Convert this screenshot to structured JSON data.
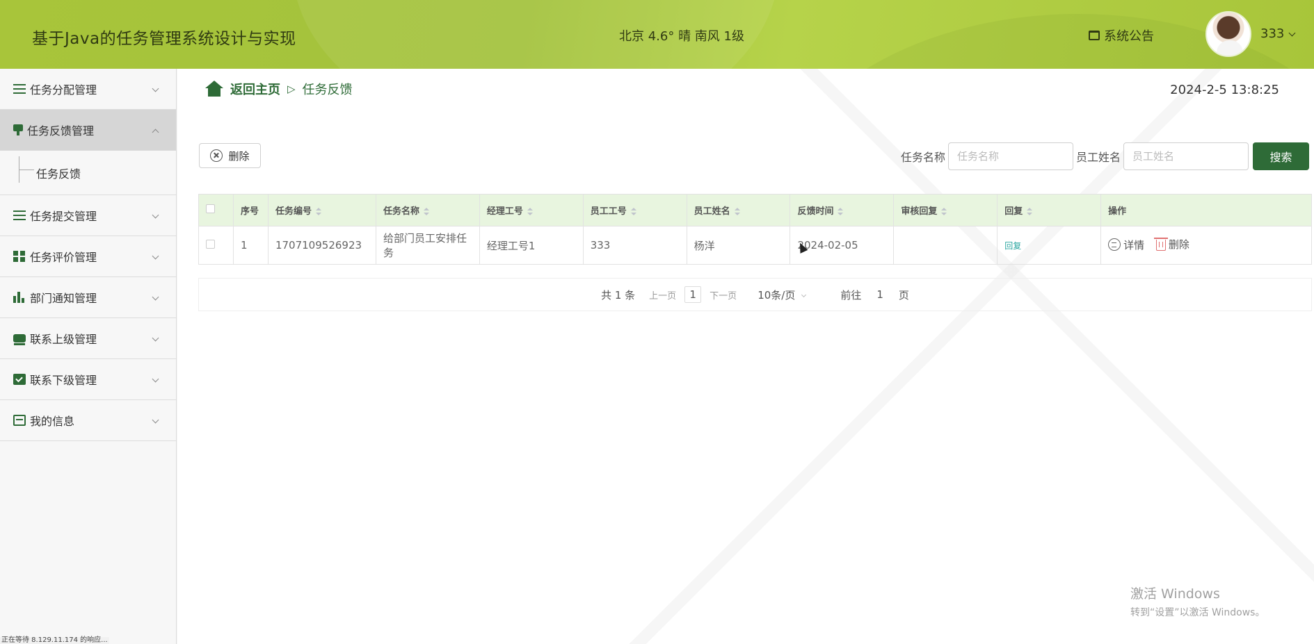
{
  "header": {
    "app_title": "基于Java的任务管理系统设计与实现",
    "weather": "北京  4.6°  晴  南风  1级",
    "announcement": "系统公告",
    "user_name": "333"
  },
  "sidebar": {
    "items": [
      {
        "label": "任务分配管理",
        "icon": "list-icon"
      },
      {
        "label": "任务反馈管理",
        "icon": "brush-icon",
        "active": true
      },
      {
        "label": "任务提交管理",
        "icon": "list-icon"
      },
      {
        "label": "任务评价管理",
        "icon": "grid-icon"
      },
      {
        "label": "部门通知管理",
        "icon": "bar-chart-icon"
      },
      {
        "label": "联系上级管理",
        "icon": "chat-icon"
      },
      {
        "label": "联系下级管理",
        "icon": "clipboard-check-icon"
      },
      {
        "label": "我的信息",
        "icon": "card-icon"
      }
    ],
    "submenu": {
      "label": "任务反馈"
    }
  },
  "breadcrumb": {
    "home": "返回主页",
    "separator": "▷",
    "current": "任务反馈"
  },
  "datetime": "2024-2-5 13:8:25",
  "toolbar": {
    "delete_label": "删除",
    "task_name_label": "任务名称",
    "task_name_placeholder": "任务名称",
    "employee_name_label": "员工姓名",
    "employee_name_placeholder": "员工姓名",
    "search_label": "搜索"
  },
  "table": {
    "headers": [
      "序号",
      "任务编号",
      "任务名称",
      "经理工号",
      "员工工号",
      "员工姓名",
      "反馈时间",
      "审核回复",
      "回复",
      "操作"
    ],
    "rows": [
      {
        "index": "1",
        "task_no": "1707109526923",
        "task_name": "给部门员工安排任务",
        "manager_no": "经理工号1",
        "employee_no": "333",
        "employee_name": "杨洋",
        "feedback_time": "2024-02-05",
        "review_reply": "",
        "reply": "回复",
        "detail": "详情",
        "delete": "删除"
      }
    ]
  },
  "pagination": {
    "total": "共 1 条",
    "prev": "上一页",
    "page": "1",
    "next": "下一页",
    "page_size": "10条/页",
    "goto_label": "前往",
    "goto_value": "1",
    "page_suffix": "页"
  },
  "watermark": {
    "line1": "激活 Windows",
    "line2": "转到“设置”以激活 Windows。"
  },
  "statusbar": "正在等待 8.129.11.174 的响应..."
}
